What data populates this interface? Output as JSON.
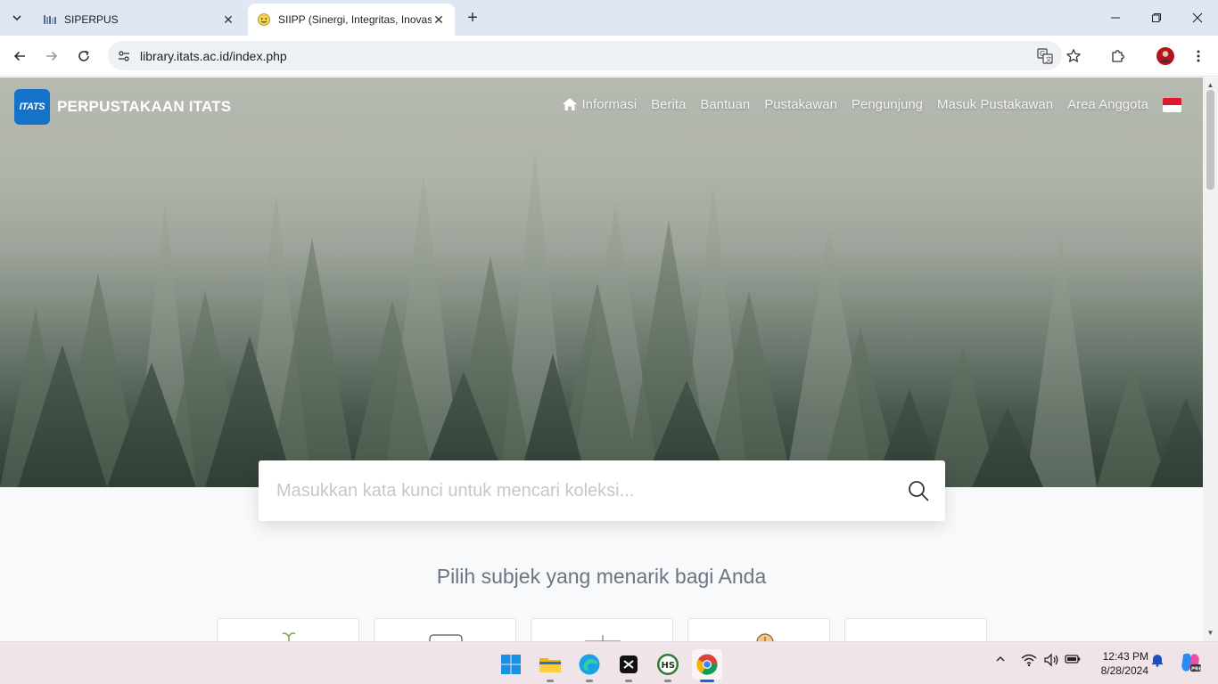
{
  "browser": {
    "tabs": [
      {
        "title": "SIPERPUS",
        "active": false
      },
      {
        "title": "SIIPP (Sinergi, Integritas, Inovasi",
        "active": true
      }
    ],
    "url": "library.itats.ac.id/index.php"
  },
  "site": {
    "logo_text": "ITATS",
    "title": "PERPUSTAKAAN ITATS",
    "nav": [
      "Informasi",
      "Berita",
      "Bantuan",
      "Pustakawan",
      "Pengunjung",
      "Masuk Pustakawan",
      "Area Anggota"
    ],
    "search_placeholder": "Masukkan kata kunci untuk mencari koleksi...",
    "subject_heading": "Pilih subjek yang menarik bagi Anda",
    "subject_card_count": 5
  },
  "taskbar": {
    "apps": [
      "start",
      "file-explorer",
      "edge-browser",
      "capcut",
      "hs-app",
      "chrome"
    ],
    "clock_time": "12:43 PM",
    "clock_date": "8/28/2024"
  },
  "colors": {
    "tabbar": "#dfe7f5",
    "logo_blue": "#1473c9",
    "taskbar": "#efe5e8"
  }
}
